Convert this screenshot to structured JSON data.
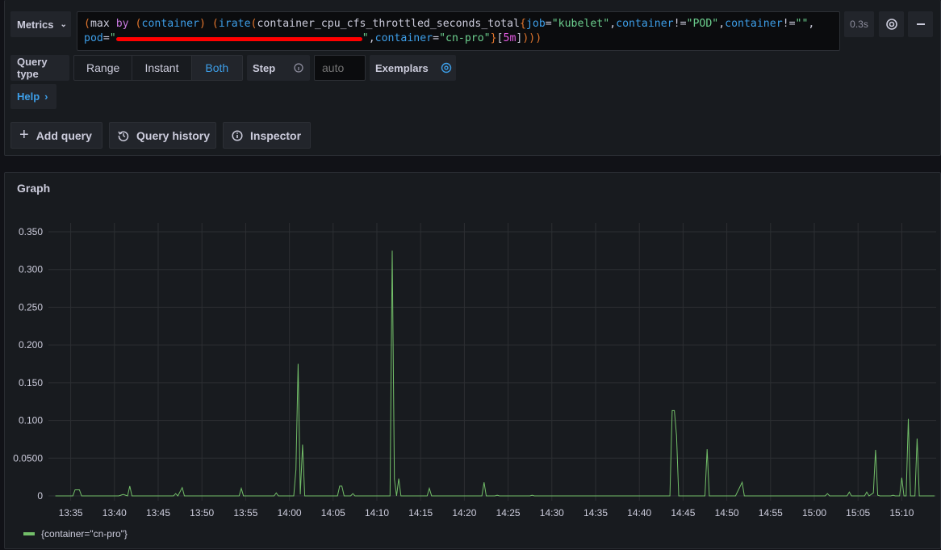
{
  "toolbar": {
    "metrics_label": "Metrics",
    "query_tokens": [
      {
        "t": "(",
        "c": "paren"
      },
      {
        "t": "max ",
        "c": "plain"
      },
      {
        "t": "by ",
        "c": "kw"
      },
      {
        "t": "(",
        "c": "paren"
      },
      {
        "t": "container",
        "c": "label"
      },
      {
        "t": ") ",
        "c": "paren"
      },
      {
        "t": "(",
        "c": "paren"
      },
      {
        "t": "irate",
        "c": "label"
      },
      {
        "t": "(",
        "c": "paren"
      },
      {
        "t": "container_cpu_cfs_throttled_seconds_total",
        "c": "plain"
      },
      {
        "t": "{",
        "c": "paren"
      },
      {
        "t": "job",
        "c": "label"
      },
      {
        "t": "=",
        "c": "plain"
      },
      {
        "t": "\"kubelet\"",
        "c": "str"
      },
      {
        "t": ",",
        "c": "plain"
      },
      {
        "t": "container",
        "c": "label"
      },
      {
        "t": "!=",
        "c": "plain"
      },
      {
        "t": "\"POD\"",
        "c": "str"
      },
      {
        "t": ",",
        "c": "plain"
      },
      {
        "t": "container",
        "c": "label"
      },
      {
        "t": "!=",
        "c": "plain"
      },
      {
        "t": "\"\"",
        "c": "str"
      },
      {
        "t": ",\n",
        "c": "plain"
      },
      {
        "t": "pod",
        "c": "label"
      },
      {
        "t": "=",
        "c": "plain"
      },
      {
        "t": "\"",
        "c": "str"
      },
      {
        "t": "",
        "c": "redacted"
      },
      {
        "t": "\"",
        "c": "str"
      },
      {
        "t": ",",
        "c": "plain"
      },
      {
        "t": "container",
        "c": "label"
      },
      {
        "t": "=",
        "c": "plain"
      },
      {
        "t": "\"cn-pro\"",
        "c": "str"
      },
      {
        "t": "}",
        "c": "paren"
      },
      {
        "t": "[",
        "c": "plain"
      },
      {
        "t": "5m",
        "c": "num"
      },
      {
        "t": "]",
        "c": "plain"
      },
      {
        "t": ")))",
        "c": "paren"
      }
    ],
    "duration": "0.3s",
    "query_type_label": "Query type",
    "query_types": [
      "Range",
      "Instant",
      "Both"
    ],
    "selected_query_type": "Both",
    "step_label": "Step",
    "step_placeholder": "auto",
    "exemplars_label": "Exemplars",
    "help_label": "Help",
    "add_query": "Add query",
    "query_history": "Query history",
    "inspector": "Inspector"
  },
  "graph": {
    "title": "Graph"
  },
  "colors": {
    "series": "#73bf69",
    "accent": "#3d9ee8"
  },
  "chart_data": {
    "type": "line",
    "xlim": [
      "13:33:15",
      "15:13:45"
    ],
    "ylim": [
      0,
      0.35
    ],
    "grid": true,
    "legend_placement": "bottom-left",
    "x_ticks": [
      "13:35",
      "13:40",
      "13:45",
      "13:50",
      "13:55",
      "14:00",
      "14:05",
      "14:10",
      "14:15",
      "14:20",
      "14:25",
      "14:30",
      "14:35",
      "14:40",
      "14:45",
      "14:50",
      "14:55",
      "15:00",
      "15:05",
      "15:10"
    ],
    "y_ticks": [
      {
        "v": 0,
        "label": "0"
      },
      {
        "v": 0.05,
        "label": "0.0500"
      },
      {
        "v": 0.1,
        "label": "0.100"
      },
      {
        "v": 0.15,
        "label": "0.150"
      },
      {
        "v": 0.2,
        "label": "0.200"
      },
      {
        "v": 0.25,
        "label": "0.250"
      },
      {
        "v": 0.3,
        "label": "0.300"
      },
      {
        "v": 0.35,
        "label": "0.350"
      }
    ],
    "series": [
      {
        "name": "{container=\"cn-pro\"}",
        "points": [
          [
            "13:33:15",
            0
          ],
          [
            "13:35:15",
            0
          ],
          [
            "13:35:30",
            0.008
          ],
          [
            "13:36:00",
            0.008
          ],
          [
            "13:36:15",
            0
          ],
          [
            "13:40:30",
            0
          ],
          [
            "13:41:00",
            0.002
          ],
          [
            "13:41:30",
            0
          ],
          [
            "13:41:45",
            0.013
          ],
          [
            "13:42:00",
            0
          ],
          [
            "13:46:45",
            0
          ],
          [
            "13:47:00",
            0.003
          ],
          [
            "13:47:15",
            0
          ],
          [
            "13:47:45",
            0.011
          ],
          [
            "13:48:00",
            0
          ],
          [
            "13:54:15",
            0
          ],
          [
            "13:54:30",
            0.01
          ],
          [
            "13:54:45",
            0
          ],
          [
            "13:58:15",
            0
          ],
          [
            "13:58:30",
            0.004
          ],
          [
            "13:58:45",
            0
          ],
          [
            "14:00:30",
            0
          ],
          [
            "14:00:45",
            0.035
          ],
          [
            "14:01:00",
            0.175
          ],
          [
            "14:01:15",
            0.002
          ],
          [
            "14:01:30",
            0.068
          ],
          [
            "14:01:45",
            0
          ],
          [
            "14:05:30",
            0
          ],
          [
            "14:05:45",
            0.013
          ],
          [
            "14:06:00",
            0.013
          ],
          [
            "14:06:15",
            0
          ],
          [
            "14:07:00",
            0
          ],
          [
            "14:07:15",
            0.003
          ],
          [
            "14:07:30",
            0
          ],
          [
            "14:11:30",
            0
          ],
          [
            "14:11:45",
            0.325
          ],
          [
            "14:12:00",
            0.022
          ],
          [
            "14:12:15",
            0
          ],
          [
            "14:12:30",
            0.023
          ],
          [
            "14:12:45",
            0
          ],
          [
            "14:15:45",
            0
          ],
          [
            "14:16:00",
            0.01
          ],
          [
            "14:16:15",
            0
          ],
          [
            "14:22:00",
            0
          ],
          [
            "14:22:15",
            0.018
          ],
          [
            "14:22:30",
            0
          ],
          [
            "14:23:30",
            0
          ],
          [
            "14:23:45",
            0.001
          ],
          [
            "14:24:00",
            0
          ],
          [
            "14:27:30",
            0
          ],
          [
            "14:27:45",
            0.001
          ],
          [
            "14:28:00",
            0
          ],
          [
            "14:43:30",
            0
          ],
          [
            "14:43:45",
            0.113
          ],
          [
            "14:44:00",
            0.113
          ],
          [
            "14:44:15",
            0.08
          ],
          [
            "14:44:30",
            0
          ],
          [
            "14:47:30",
            0
          ],
          [
            "14:47:45",
            0.062
          ],
          [
            "14:48:00",
            0
          ],
          [
            "14:51:00",
            0
          ],
          [
            "14:51:45",
            0.018
          ],
          [
            "14:52:00",
            0
          ],
          [
            "15:01:15",
            0
          ],
          [
            "15:01:30",
            0.003
          ],
          [
            "15:01:45",
            0
          ],
          [
            "15:03:45",
            0
          ],
          [
            "15:04:00",
            0.005
          ],
          [
            "15:04:15",
            0
          ],
          [
            "15:05:45",
            0
          ],
          [
            "15:06:00",
            0.005
          ],
          [
            "15:06:15",
            0
          ],
          [
            "15:06:45",
            0.004
          ],
          [
            "15:07:00",
            0.061
          ],
          [
            "15:07:15",
            0.001
          ],
          [
            "15:07:30",
            0
          ],
          [
            "15:08:45",
            0
          ],
          [
            "15:09:00",
            0.001
          ],
          [
            "15:09:15",
            0
          ],
          [
            "15:09:45",
            0
          ],
          [
            "15:10:00",
            0.024
          ],
          [
            "15:10:15",
            0
          ],
          [
            "15:10:30",
            0
          ],
          [
            "15:10:45",
            0.102
          ],
          [
            "15:11:00",
            0
          ],
          [
            "15:11:30",
            0
          ],
          [
            "15:11:45",
            0.076
          ],
          [
            "15:12:00",
            0
          ],
          [
            "15:13:45",
            0
          ]
        ]
      }
    ]
  }
}
